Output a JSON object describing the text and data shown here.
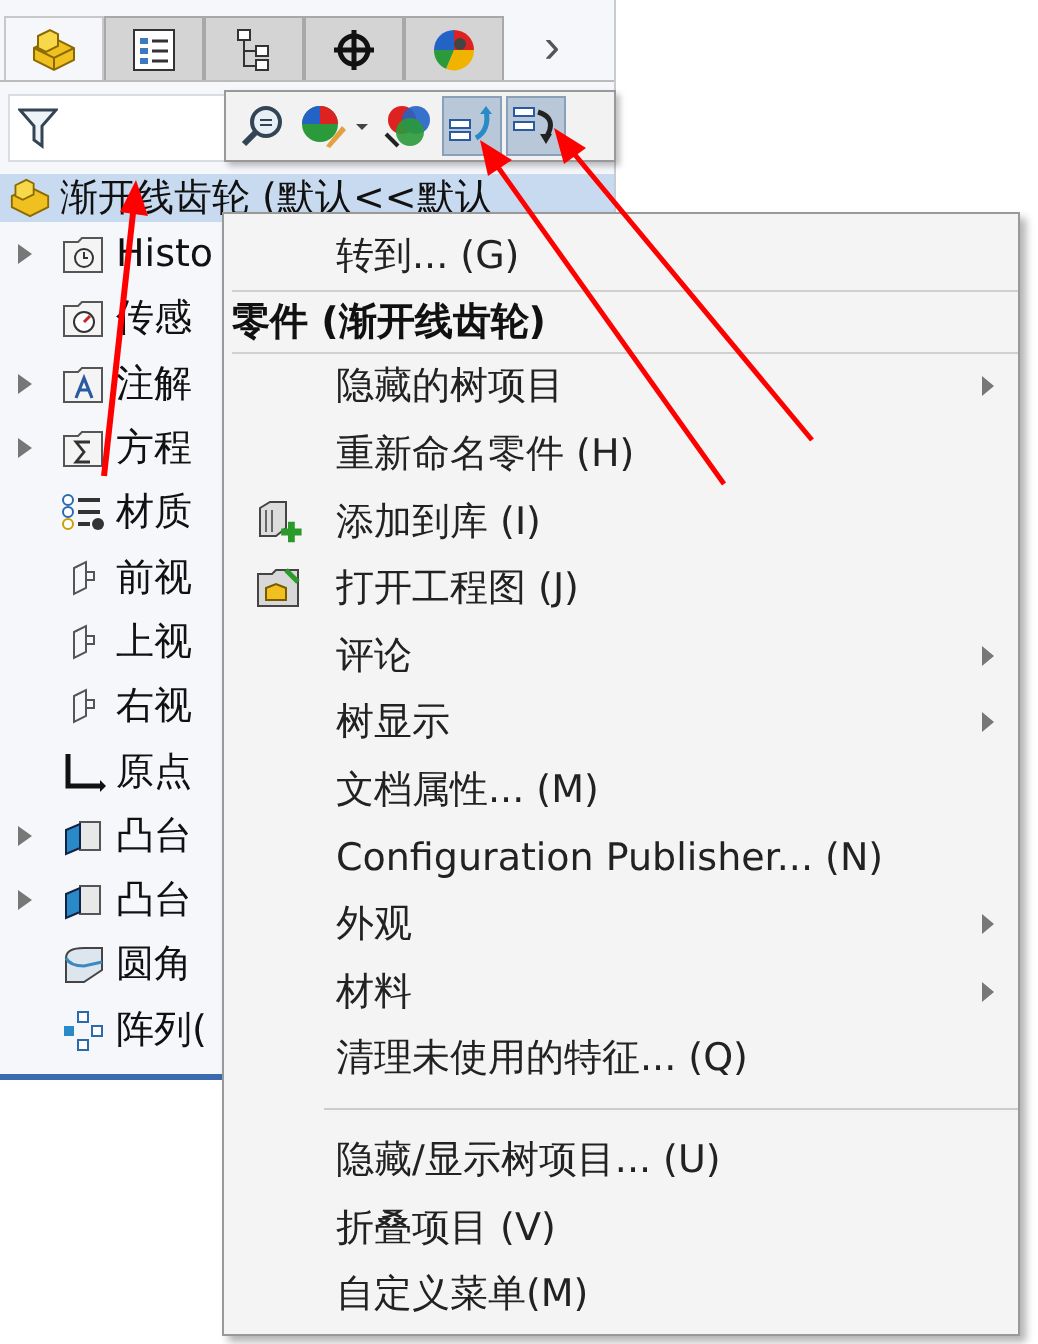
{
  "panel_tabs": [
    {
      "kind": "features",
      "selected": true
    },
    {
      "kind": "properties",
      "selected": false
    },
    {
      "kind": "config",
      "selected": false
    },
    {
      "kind": "dimxpert",
      "selected": false
    },
    {
      "kind": "display",
      "selected": false
    }
  ],
  "tabs_more": "›",
  "toolbar": [
    {
      "kind": "zoom",
      "highlighted": false
    },
    {
      "kind": "appearance",
      "highlighted": false
    },
    {
      "kind": "scene",
      "highlighted": false
    },
    {
      "kind": "expand",
      "highlighted": true
    },
    {
      "kind": "collapse",
      "highlighted": true
    }
  ],
  "tree": {
    "root": "渐开线齿轮 (默认<<默认",
    "items": [
      {
        "kind": "history",
        "label": "Histo",
        "expandable": true
      },
      {
        "kind": "sensor",
        "label": "传感",
        "expandable": false
      },
      {
        "kind": "annotation",
        "label": "注解",
        "expandable": true
      },
      {
        "kind": "equation",
        "label": "方程",
        "expandable": true
      },
      {
        "kind": "material",
        "label": "材质",
        "expandable": false
      },
      {
        "kind": "plane",
        "label": "前视",
        "expandable": false
      },
      {
        "kind": "plane",
        "label": "上视",
        "expandable": false
      },
      {
        "kind": "plane",
        "label": "右视",
        "expandable": false
      },
      {
        "kind": "origin",
        "label": "原点",
        "expandable": false
      },
      {
        "kind": "extrude",
        "label": "凸台",
        "expandable": true
      },
      {
        "kind": "extrude",
        "label": "凸台",
        "expandable": true
      },
      {
        "kind": "fillet",
        "label": "圆角",
        "expandable": false
      },
      {
        "kind": "pattern",
        "label": "阵列(",
        "expandable": false
      }
    ]
  },
  "context_menu": [
    {
      "kind": "item",
      "label": "转到... (G)",
      "submenu": false
    },
    {
      "kind": "header",
      "label": "零件 (渐开线齿轮)"
    },
    {
      "kind": "item",
      "label": "隐藏的树项目",
      "submenu": true
    },
    {
      "kind": "item",
      "label": "重新命名零件 (H)",
      "submenu": false
    },
    {
      "kind": "library_item",
      "label": "添加到库 (I)",
      "submenu": false
    },
    {
      "kind": "drawing_item",
      "label": "打开工程图 (J)",
      "submenu": false
    },
    {
      "kind": "item",
      "label": "评论",
      "submenu": true
    },
    {
      "kind": "item",
      "label": "树显示",
      "submenu": true
    },
    {
      "kind": "item",
      "label": "文档属性... (M)",
      "submenu": false
    },
    {
      "kind": "item",
      "label": "Configuration Publisher... (N)",
      "submenu": false
    },
    {
      "kind": "item",
      "label": "外观",
      "submenu": true
    },
    {
      "kind": "item",
      "label": "材料",
      "submenu": true
    },
    {
      "kind": "item",
      "label": "清理未使用的特征... (Q)",
      "submenu": false
    },
    {
      "kind": "separator"
    },
    {
      "kind": "item",
      "label": "隐藏/显示树项目... (U)",
      "submenu": false
    },
    {
      "kind": "item",
      "label": "折叠项目 (V)",
      "submenu": false
    },
    {
      "kind": "item",
      "label": "自定义菜单(M)",
      "submenu": false
    }
  ]
}
